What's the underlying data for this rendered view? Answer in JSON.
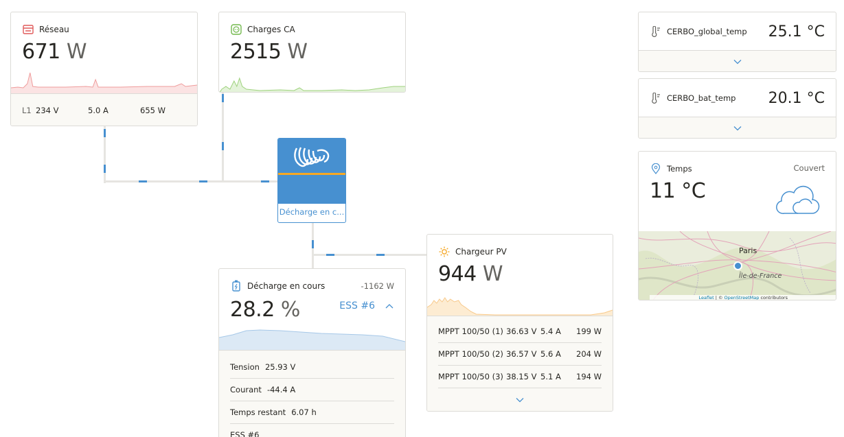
{
  "grid": {
    "title": "Réseau",
    "value": "671",
    "unit": "W",
    "phase_label": "L1",
    "voltage": "234 V",
    "current": "5.0 A",
    "power": "655 W"
  },
  "ac_loads": {
    "title": "Charges CA",
    "value": "2515",
    "unit": "W"
  },
  "inverter": {
    "status": "Décharge en c..."
  },
  "battery": {
    "title": "Décharge en cours",
    "power": "-1162 W",
    "value": "28.2",
    "unit": "%",
    "ess_label": "ESS #6",
    "rows": [
      {
        "label": "Tension",
        "value": "25.93 V"
      },
      {
        "label": "Courant",
        "value": "-44.4 A"
      },
      {
        "label": "Temps restant",
        "value": "6.07 h"
      }
    ],
    "last_row": "ESS #6"
  },
  "pv": {
    "title": "Chargeur PV",
    "value": "944",
    "unit": "W",
    "chargers": [
      {
        "name": "MPPT 100/50 (1)",
        "voltage": "36.63 V",
        "current": "5.4 A",
        "power": "199 W"
      },
      {
        "name": "MPPT 100/50 (2)",
        "voltage": "36.57 V",
        "current": "5.6 A",
        "power": "204 W"
      },
      {
        "name": "MPPT 100/50 (3)",
        "voltage": "38.15 V",
        "current": "5.1 A",
        "power": "194 W"
      }
    ]
  },
  "temps": [
    {
      "name": "CERBO_global_temp",
      "value": "25.1 °C"
    },
    {
      "name": "CERBO_bat_temp",
      "value": "20.1 °C"
    }
  ],
  "weather": {
    "title": "Temps",
    "condition": "Couvert",
    "value": "11 °C",
    "map_city": "Paris",
    "map_region": "Île-de-France",
    "attribution_leaflet": "Leaflet",
    "attribution_sep": "| ©",
    "attribution_osm": "OpenStreetMap",
    "attribution_tail": "contributors"
  },
  "colors": {
    "accent": "#4790d0",
    "grid": "#e05a5a",
    "ac": "#72b84c",
    "pv": "#f5a623",
    "inverter_orange": "#f7a823"
  }
}
